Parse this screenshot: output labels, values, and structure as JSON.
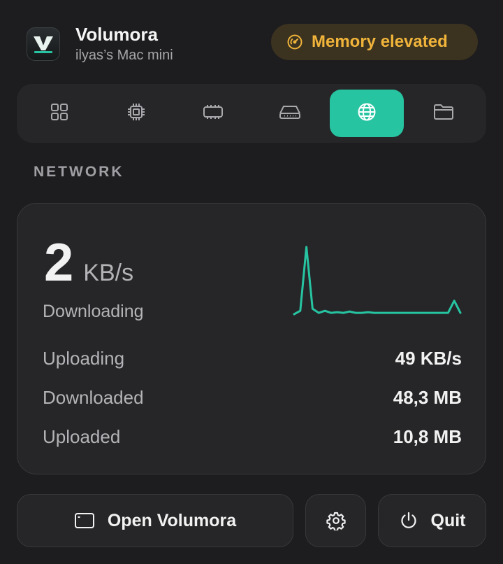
{
  "header": {
    "app_title": "Volumora",
    "subtitle": "ilyas’s Mac mini",
    "app_icon": "volumora-app-icon"
  },
  "status_badge": {
    "label": "Memory elevated",
    "icon": "gauge-icon",
    "color": "#f0b43a",
    "background": "#3b3220"
  },
  "tabs": [
    {
      "icon": "grid-icon",
      "active": false
    },
    {
      "icon": "cpu-icon",
      "active": false
    },
    {
      "icon": "memory-icon",
      "active": false
    },
    {
      "icon": "disk-icon",
      "active": false
    },
    {
      "icon": "globe-icon",
      "active": true
    },
    {
      "icon": "folder-icon",
      "active": false
    }
  ],
  "accent_color": "#27c4a2",
  "section": {
    "label": "NETWORK"
  },
  "network": {
    "download_rate_value": "2",
    "download_rate_unit": "KB/s",
    "download_caption": "Downloading",
    "stats": [
      {
        "label": "Uploading",
        "value": "49 KB/s"
      },
      {
        "label": "Downloaded",
        "value": "48,3 MB"
      },
      {
        "label": "Uploaded",
        "value": "10,8 MB"
      }
    ],
    "sparkline": [
      0,
      0.05,
      1.0,
      0.08,
      0.02,
      0.05,
      0.02,
      0.03,
      0.02,
      0.04,
      0.02,
      0.02,
      0.03,
      0.02,
      0.02,
      0.02,
      0.02,
      0.02,
      0.02,
      0.02,
      0.02,
      0.02,
      0.02,
      0.02,
      0.02,
      0.02,
      0.2,
      0.02
    ]
  },
  "buttons": {
    "open_label": "Open Volumora",
    "quit_label": "Quit"
  }
}
